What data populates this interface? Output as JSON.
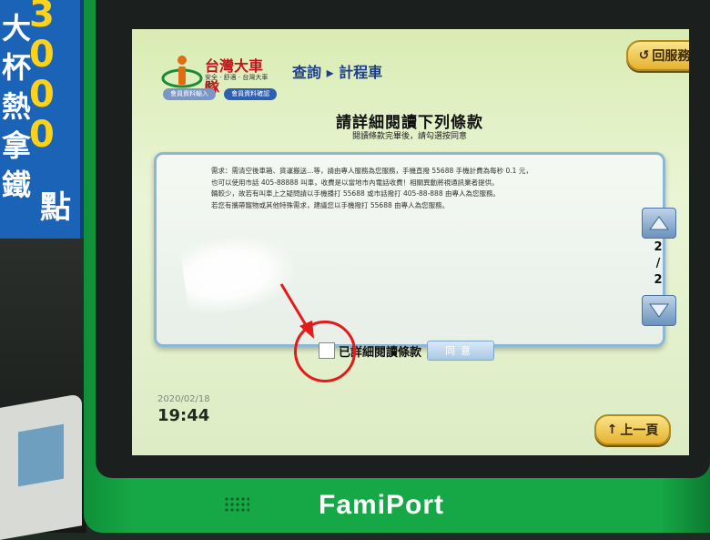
{
  "sign": {
    "chars": [
      "大",
      "杯",
      "熱",
      "拿",
      "鐵"
    ],
    "digits": [
      "3",
      "0",
      "0",
      "0"
    ],
    "points_label": "點"
  },
  "brand": {
    "name": "FamiPort"
  },
  "screen": {
    "logo": {
      "name": "台灣大車隊",
      "tagline": "安全 · 舒適 · 台灣大車隊"
    },
    "steps": [
      "會員資料輸入",
      "會員資料確認"
    ],
    "breadcrumb": "查詢 ▸ 計程車",
    "back_label": "回服務",
    "heading": "請詳細閱讀下列條款",
    "subheading": "閱讀條款完畢後，請勾選按同意",
    "terms_lines": [
      "需求：需清空後車箱、貨運搬送…等，請由專人服務為您服務，手機直撥 55688 手機計費為每秒 0.1 元，",
      "也可以使用市話 405-88888 叫車，收費是以當地市內電話收費！相關異動將視通訊業者提供。",
      "輛較少，故若有叫車上之疑問請以手機播打 55688 或市話撥打 405-88-888 由專人為您服務。",
      "若您有攜帶寵物或其他特殊需求，建議您以手機撥打 55688 由專人為您服務。"
    ],
    "page_current": "2",
    "page_total": "2",
    "agree_label": "已詳細閱讀條款",
    "agree_button": "同意",
    "date": "2020/02/18",
    "time": "19:44",
    "prev_label": "上一頁"
  },
  "colors": {
    "kiosk_green": "#16a846",
    "accent_blue": "#1b3f8a",
    "button_gold": "#e5b230",
    "annotation_red": "#e31b1b"
  }
}
